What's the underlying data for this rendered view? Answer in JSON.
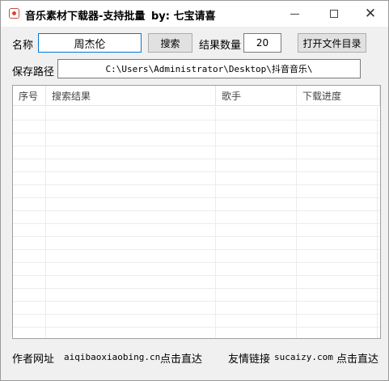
{
  "window": {
    "title": "音乐素材下载器-支持批量",
    "by_label": "by:  七宝请喜",
    "close_glyph": "✕"
  },
  "search": {
    "name_label": "名称",
    "name_value": "周杰伦",
    "search_button": "搜索",
    "count_label": "结果数量",
    "count_value": "20",
    "open_dir_button": "打开文件目录"
  },
  "save": {
    "path_label": "保存路径",
    "path_value": "C:\\Users\\Administrator\\Desktop\\抖音音乐\\"
  },
  "table": {
    "columns": [
      "序号",
      "搜索结果",
      "歌手",
      "下载进度"
    ],
    "rows": []
  },
  "footer": {
    "author_label": "作者网址",
    "author_url": "aiqibaoxiaobing.cn",
    "author_link": "点击直达",
    "friend_label": "友情链接",
    "friend_url": "sucaizy.com",
    "friend_link": "点击直达"
  }
}
